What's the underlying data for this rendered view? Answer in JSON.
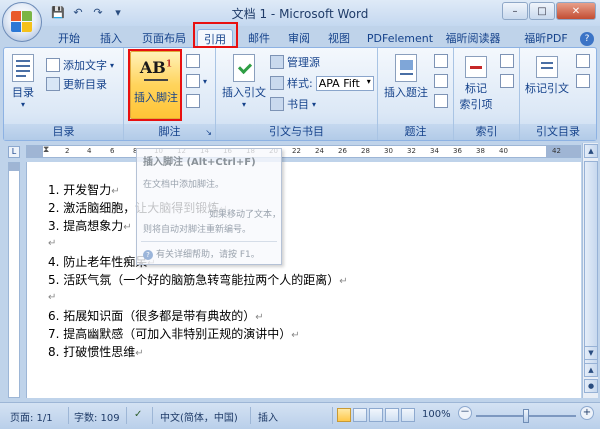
{
  "window": {
    "title": "文档 1 - Microsoft Word",
    "minimize": "–",
    "maximize": "□",
    "close": "✕"
  },
  "quick_access": {
    "save_icon": "💾",
    "undo_icon": "↶",
    "redo_icon": "↷",
    "extra_icon": "▾"
  },
  "tabs": [
    {
      "label": "开始"
    },
    {
      "label": "插入"
    },
    {
      "label": "页面布局"
    },
    {
      "label": "引用"
    },
    {
      "label": "邮件"
    },
    {
      "label": "审阅"
    },
    {
      "label": "视图"
    },
    {
      "label": "PDFelement"
    },
    {
      "label": "福昕阅读器"
    },
    {
      "label": "福昕PDF"
    }
  ],
  "ribbon": {
    "toc": {
      "big_label": "目录",
      "add_text": "添加文字",
      "update_toc": "更新目录",
      "group_label": "目录"
    },
    "footnotes": {
      "insert_footnote": "插入脚注",
      "icon_text": "AB",
      "icon_sup": "1",
      "group_label": "脚注"
    },
    "citations": {
      "insert_citation": "插入引文",
      "manage_sources": "管理源",
      "style_label": "样式:",
      "style_value": "APA Fift",
      "bibliography": "书目",
      "group_label": "引文与书目"
    },
    "captions": {
      "insert_caption": "插入题注",
      "group_label": "题注"
    },
    "index": {
      "mark_entry_line1": "标记",
      "mark_entry_line2": "索引项",
      "group_label": "索引"
    },
    "toa": {
      "mark_citation": "标记引文",
      "group_label": "引文目录"
    }
  },
  "ruler": {
    "numbers": [
      "2",
      "4",
      "6",
      "8",
      "10",
      "12",
      "14",
      "16",
      "18",
      "20",
      "22",
      "24",
      "26",
      "28",
      "30",
      "32",
      "34",
      "36",
      "38",
      "40",
      "42"
    ]
  },
  "tooltip": {
    "title": "插入脚注 (Alt+Ctrl+F)",
    "line1": "在文档中添加脚注。",
    "line2": "如果移动了文本，",
    "line3": "则将自动对脚注重新编号。",
    "help": "有关详细帮助，请按 F1。"
  },
  "document": {
    "lines": [
      "1. 开发智力",
      "2. 激活脑细胞，让大脑得到锻炼",
      "3. 提高想象力",
      "",
      "4. 防止老年性痴呆",
      "5. 活跃气氛（一个好的脑筋急转弯能拉两个人的距离）",
      "",
      "6. 拓展知识面（很多都是带有典故的）",
      "7. 提高幽默感（可加入非特别正规的演讲中）",
      "8. 打破惯性思维"
    ],
    "paragraph_mark": "↵"
  },
  "statusbar": {
    "page": "页面: 1/1",
    "words": "字数: 109",
    "language": "中文(简体，中国)",
    "mode": "插入",
    "zoom": "100%",
    "zoom_minus": "－",
    "zoom_plus": "+"
  }
}
